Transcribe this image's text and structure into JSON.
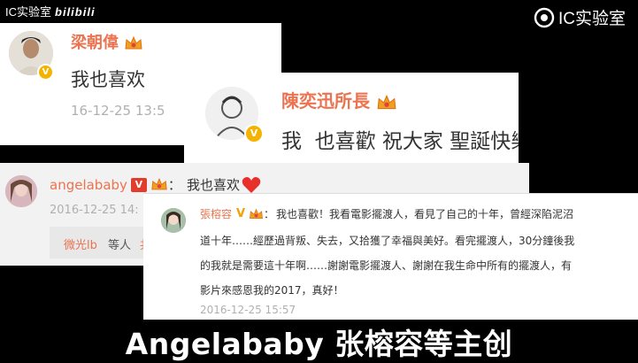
{
  "watermark": {
    "left_text": "IC实验室",
    "left_brand": "bilibili",
    "right_text": "IC实验室",
    "right_icon": "ic-lab-logo-icon"
  },
  "post1": {
    "user_name": "梁朝偉",
    "text": "我也喜欢",
    "time": "16-12-25 13:5",
    "badge": "V"
  },
  "post2": {
    "user_name": "陳奕迅所長",
    "text": "我  也喜歡 祝大家 聖誕快樂",
    "badge": "V"
  },
  "post3": {
    "user_name": "angelababy",
    "colon": "：",
    "text": "我也喜欢",
    "time": "2016-12-25 14:",
    "repost_user": "微光lb",
    "repost_suffix": "等人",
    "repost_tail": "共",
    "badge": "V"
  },
  "post4": {
    "user_name": "張榕容",
    "colon": "：",
    "line1": "我也喜歡！我看電影擺渡人，看見了自己的十年，曾經深陷泥沼",
    "line2": "道十年……經歷過背叛、失去，又拾獲了幸福與美好。看完擺渡人，30分鐘後我",
    "line3": "的我就是需要這十年啊……謝謝電影擺渡人、謝謝在我生命中所有的擺渡人，有",
    "line4": "影片來感恩我的2017，真好！",
    "time": "2016-12-25 15:57",
    "badge": "V"
  },
  "subtitle": "Angelababy 张榕容等主创"
}
